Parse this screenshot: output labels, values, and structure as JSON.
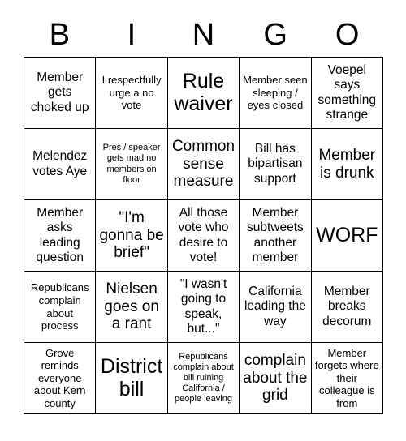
{
  "card": {
    "header_letters": [
      "B",
      "I",
      "N",
      "G",
      "O"
    ],
    "rows": [
      [
        {
          "text": "Member gets choked up",
          "size": "m"
        },
        {
          "text": "I respectfully urge a no vote",
          "size": "s"
        },
        {
          "text": "Rule waiver",
          "size": "xl"
        },
        {
          "text": "Member seen sleeping / eyes closed",
          "size": "s"
        },
        {
          "text": "Voepel says something strange",
          "size": "m"
        }
      ],
      [
        {
          "text": "Melendez votes Aye",
          "size": "m"
        },
        {
          "text": "Pres / speaker gets mad no members on floor",
          "size": "xs"
        },
        {
          "text": "Common sense measure",
          "size": "l"
        },
        {
          "text": "Bill has bipartisan support",
          "size": "m"
        },
        {
          "text": "Member is drunk",
          "size": "l"
        }
      ],
      [
        {
          "text": "Member asks leading question",
          "size": "m"
        },
        {
          "text": "\"I'm gonna be brief\"",
          "size": "l"
        },
        {
          "text": "All those vote who desire to vote!",
          "size": "m"
        },
        {
          "text": "Member subtweets another member",
          "size": "m"
        },
        {
          "text": "WORF",
          "size": "xl"
        }
      ],
      [
        {
          "text": "Republicans complain about process",
          "size": "s"
        },
        {
          "text": "Nielsen goes on a rant",
          "size": "l"
        },
        {
          "text": "\"I wasn't going to speak, but...\"",
          "size": "m"
        },
        {
          "text": "California leading the way",
          "size": "m"
        },
        {
          "text": "Member breaks decorum",
          "size": "m"
        }
      ],
      [
        {
          "text": "Grove reminds everyone about Kern county",
          "size": "s"
        },
        {
          "text": "District bill",
          "size": "xl"
        },
        {
          "text": "Republicans complain about bill ruining California / people leaving",
          "size": "xs"
        },
        {
          "text": "complain about the grid",
          "size": "l"
        },
        {
          "text": "Member forgets where their colleague is from",
          "size": "s"
        }
      ]
    ]
  },
  "colors": {
    "background": "#ffffff",
    "text": "#000000",
    "grid_line": "#000000"
  }
}
